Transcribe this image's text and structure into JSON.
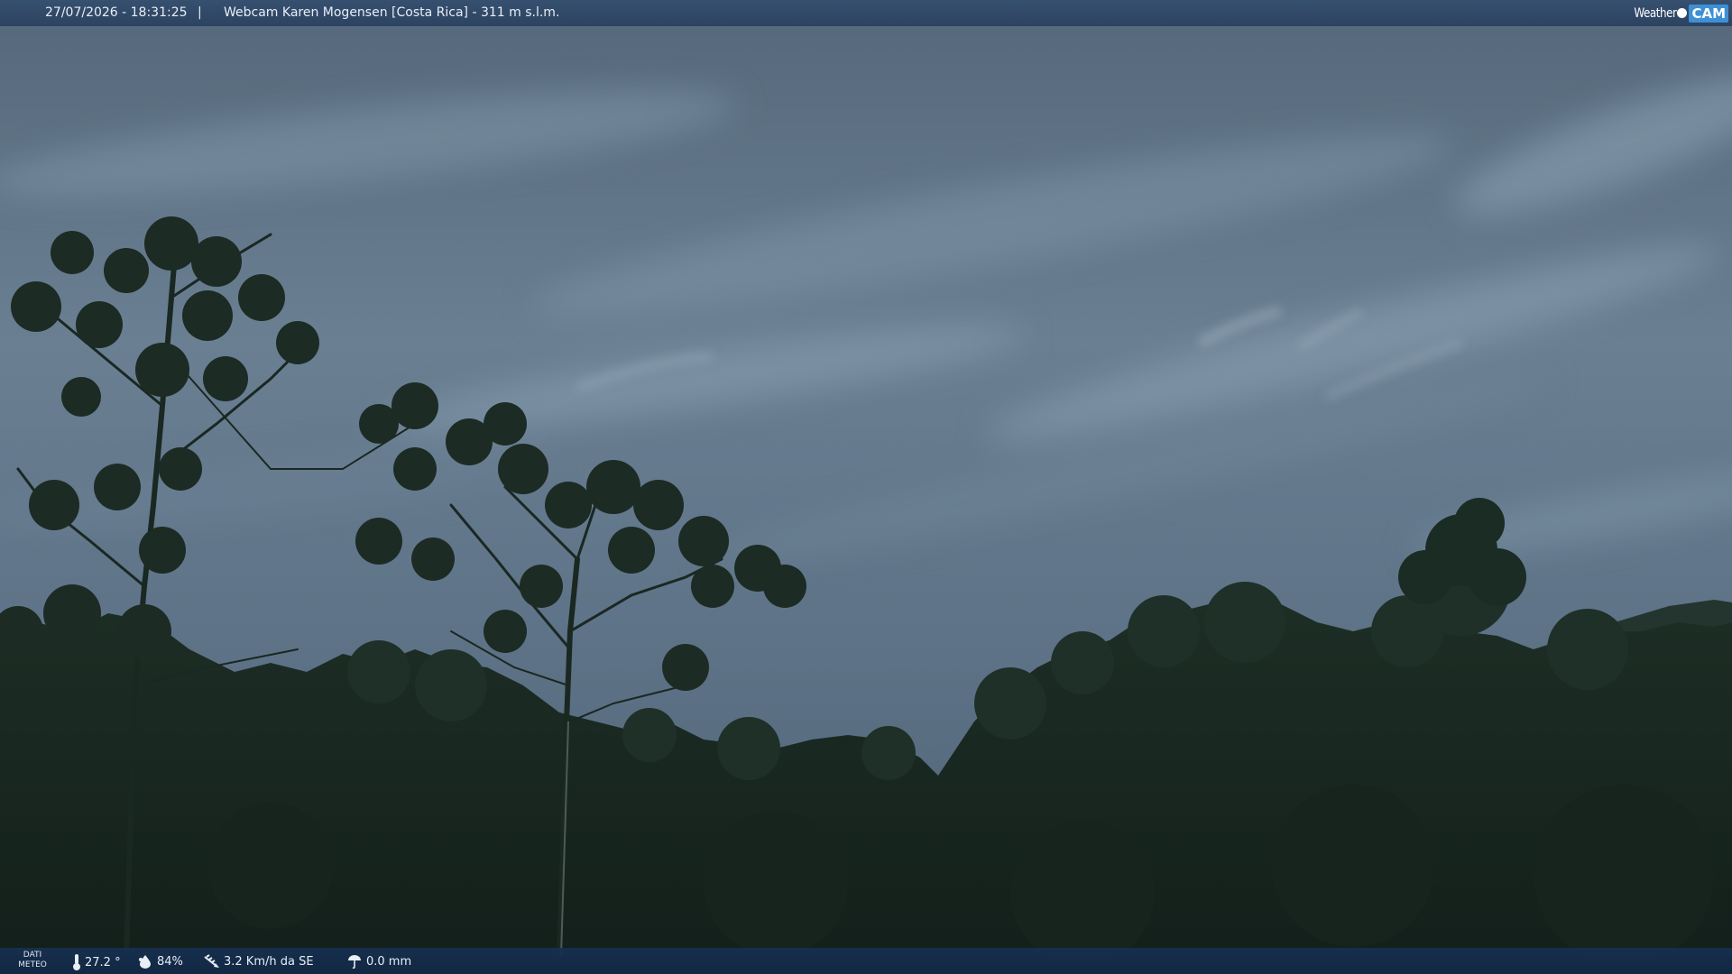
{
  "header": {
    "datetime": "27/07/2026 - 18:31:25",
    "separator": "|",
    "title": "Webcam Karen Mogensen [Costa Rica]  - 311 m s.l.m.",
    "brand_left": "Weather",
    "brand_right": "CAM"
  },
  "footer": {
    "label_line1": "DATI",
    "label_line2": "METEO",
    "temperature": "27.2 °",
    "humidity": "84%",
    "wind": "3.2 Km/h da SE",
    "rain": "0.0 mm"
  },
  "icons": {
    "temperature": "thermometer-icon",
    "humidity": "humidity-drop-icon",
    "wind": "wind-icon",
    "rain": "rain-icon"
  },
  "colors": {
    "bar_top": "#34506e",
    "bar_bottom": "#163050",
    "brand_accent": "#3d8fd6",
    "sky": "#5f7487",
    "forest": "#1a2a22"
  }
}
